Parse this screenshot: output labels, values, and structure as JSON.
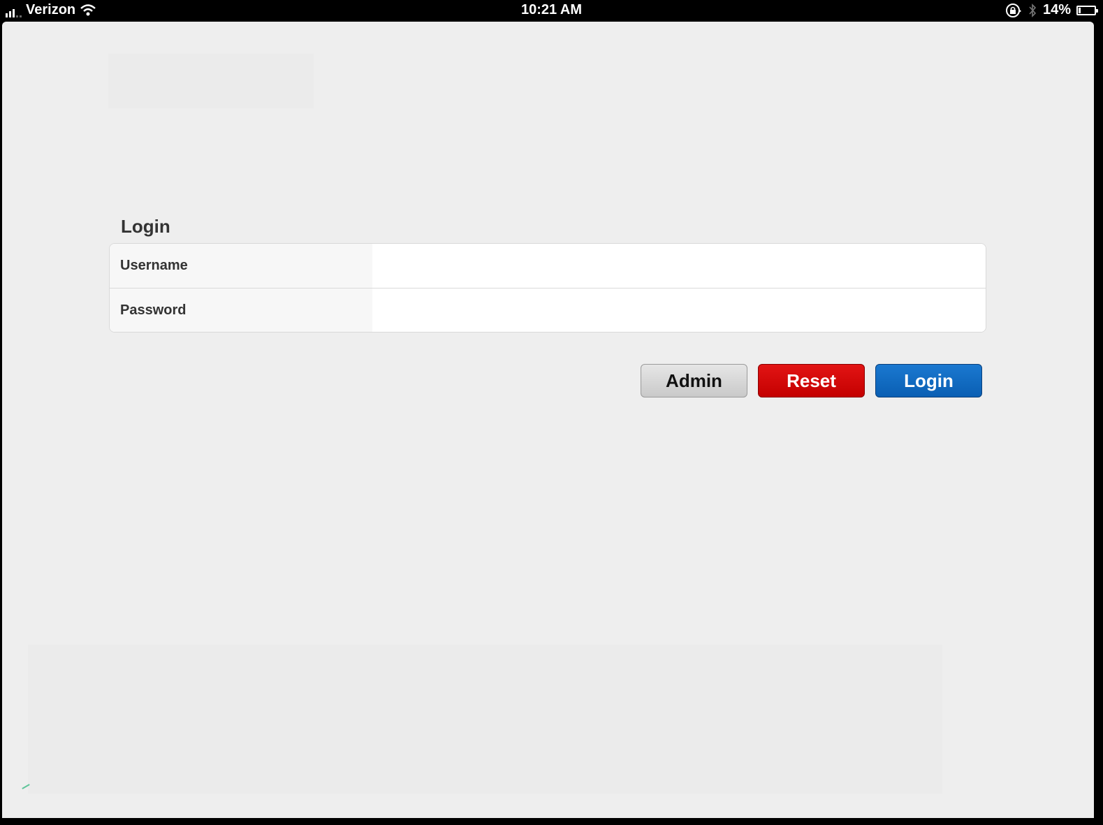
{
  "status_bar": {
    "carrier": "Verizon",
    "time": "10:21 AM",
    "battery_percent": "14%",
    "icons": [
      "signal-icon",
      "wifi-icon",
      "rotation-lock-icon",
      "bluetooth-icon",
      "battery-icon"
    ]
  },
  "login": {
    "heading": "Login",
    "fields": [
      {
        "label": "Username",
        "value": "",
        "placeholder": ""
      },
      {
        "label": "Password",
        "value": "",
        "placeholder": ""
      }
    ],
    "buttons": {
      "admin": "Admin",
      "reset": "Reset",
      "login": "Login"
    }
  },
  "colors": {
    "reset_button": "#d40a0a",
    "login_button": "#1068c0",
    "admin_button": "#d6d6d6",
    "background": "#eeeeee"
  }
}
